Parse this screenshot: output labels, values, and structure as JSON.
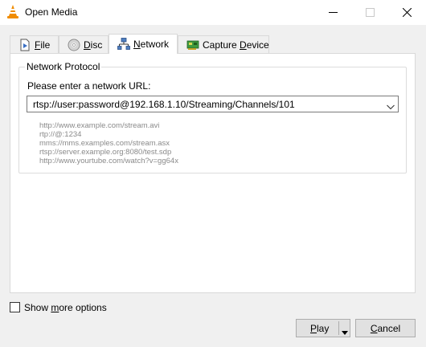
{
  "window": {
    "title": "Open Media",
    "icon": "vlc-cone-icon"
  },
  "tabs": [
    {
      "label_pre": "",
      "label_ul": "F",
      "label_post": "ile",
      "icon": "file-icon",
      "active": false
    },
    {
      "label_pre": "",
      "label_ul": "D",
      "label_post": "isc",
      "icon": "disc-icon",
      "active": false
    },
    {
      "label_pre": "",
      "label_ul": "N",
      "label_post": "etwork",
      "icon": "network-icon",
      "active": true
    },
    {
      "label_pre": "Capture ",
      "label_ul": "D",
      "label_post": "evice",
      "icon": "capture-card-icon",
      "active": false
    }
  ],
  "network": {
    "group_title": "Network Protocol",
    "url_prompt": "Please enter a network URL:",
    "url_value": "rtsp://user:password@192.168.1.10/Streaming/Channels/101",
    "examples": [
      "http://www.example.com/stream.avi",
      "rtp://@:1234",
      "mms://mms.examples.com/stream.asx",
      "rtsp://server.example.org:8080/test.sdp",
      "http://www.yourtube.com/watch?v=gg64x"
    ]
  },
  "options": {
    "pre": "Show ",
    "ul": "m",
    "post": "ore options",
    "checked": false
  },
  "buttons": {
    "play": {
      "ul": "P",
      "post": "lay"
    },
    "cancel": {
      "ul": "C",
      "post": "ancel"
    }
  },
  "colors": {
    "vlc_orange": "#f08c00",
    "panel_bg": "#ffffff",
    "dialog_bg": "#f0f0f0",
    "button_bg": "#e1e1e1",
    "example_text": "#8a8a8a"
  }
}
